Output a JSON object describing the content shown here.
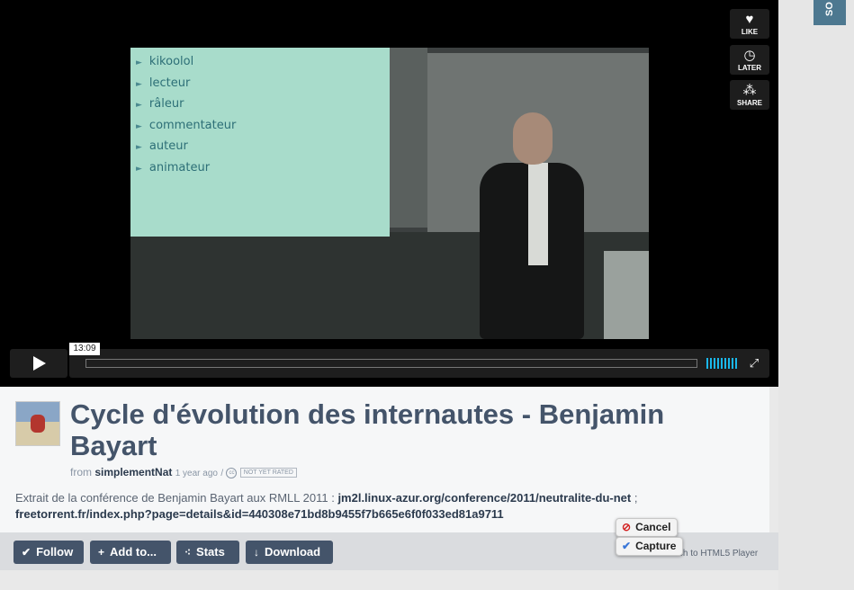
{
  "side_tab": {
    "label": "SO"
  },
  "player": {
    "slide_items": [
      "kikoolol",
      "lecteur",
      "râleur",
      "commentateur",
      "auteur",
      "animateur"
    ],
    "bullet": "►",
    "actions": [
      {
        "name": "like",
        "label": "LIKE",
        "icon": "heart-icon",
        "glyph": "♥"
      },
      {
        "name": "later",
        "label": "LATER",
        "icon": "clock-icon",
        "glyph": "◷"
      },
      {
        "name": "share",
        "label": "SHARE",
        "icon": "share-icon",
        "glyph": "⁂"
      }
    ],
    "timecode": "13:09",
    "fullscreen_glyph": "⤢"
  },
  "video": {
    "title": "Cycle d'évolution des internautes - Benjamin Bayart",
    "from_label": "from",
    "author": "simplementNat",
    "age": "1 year ago",
    "separator": "/",
    "cc_glyph": "cc",
    "rating": "NOT YET RATED",
    "description_text": "Extrait de la conférence de Benjamin Bayart aux RMLL 2011 :",
    "link1": "jm2l.linux-azur.org/conference/2011/neutralite-du-net",
    "link_separator": ";",
    "link2": "freetorrent.fr/index.php?page=details&id=440308e71bd8b9455f7b665e6f0f033ed81a9711"
  },
  "toolbar": {
    "follow": {
      "icon": "✔",
      "label": "Follow"
    },
    "add": {
      "icon": "+",
      "label": "Add to..."
    },
    "stats": {
      "icon": "⁖",
      "label": "Stats"
    },
    "download": {
      "icon": "↓",
      "label": "Download"
    },
    "html5": "Switch to HTML5 Player"
  },
  "popup": {
    "cancel_icon": "⊘",
    "cancel": "Cancel",
    "capture_icon": "✔",
    "capture": "Capture"
  },
  "colors": {
    "title": "#44546a",
    "button": "#44546a",
    "accent": "#1ab7ea",
    "side_tab": "#4d7890"
  }
}
